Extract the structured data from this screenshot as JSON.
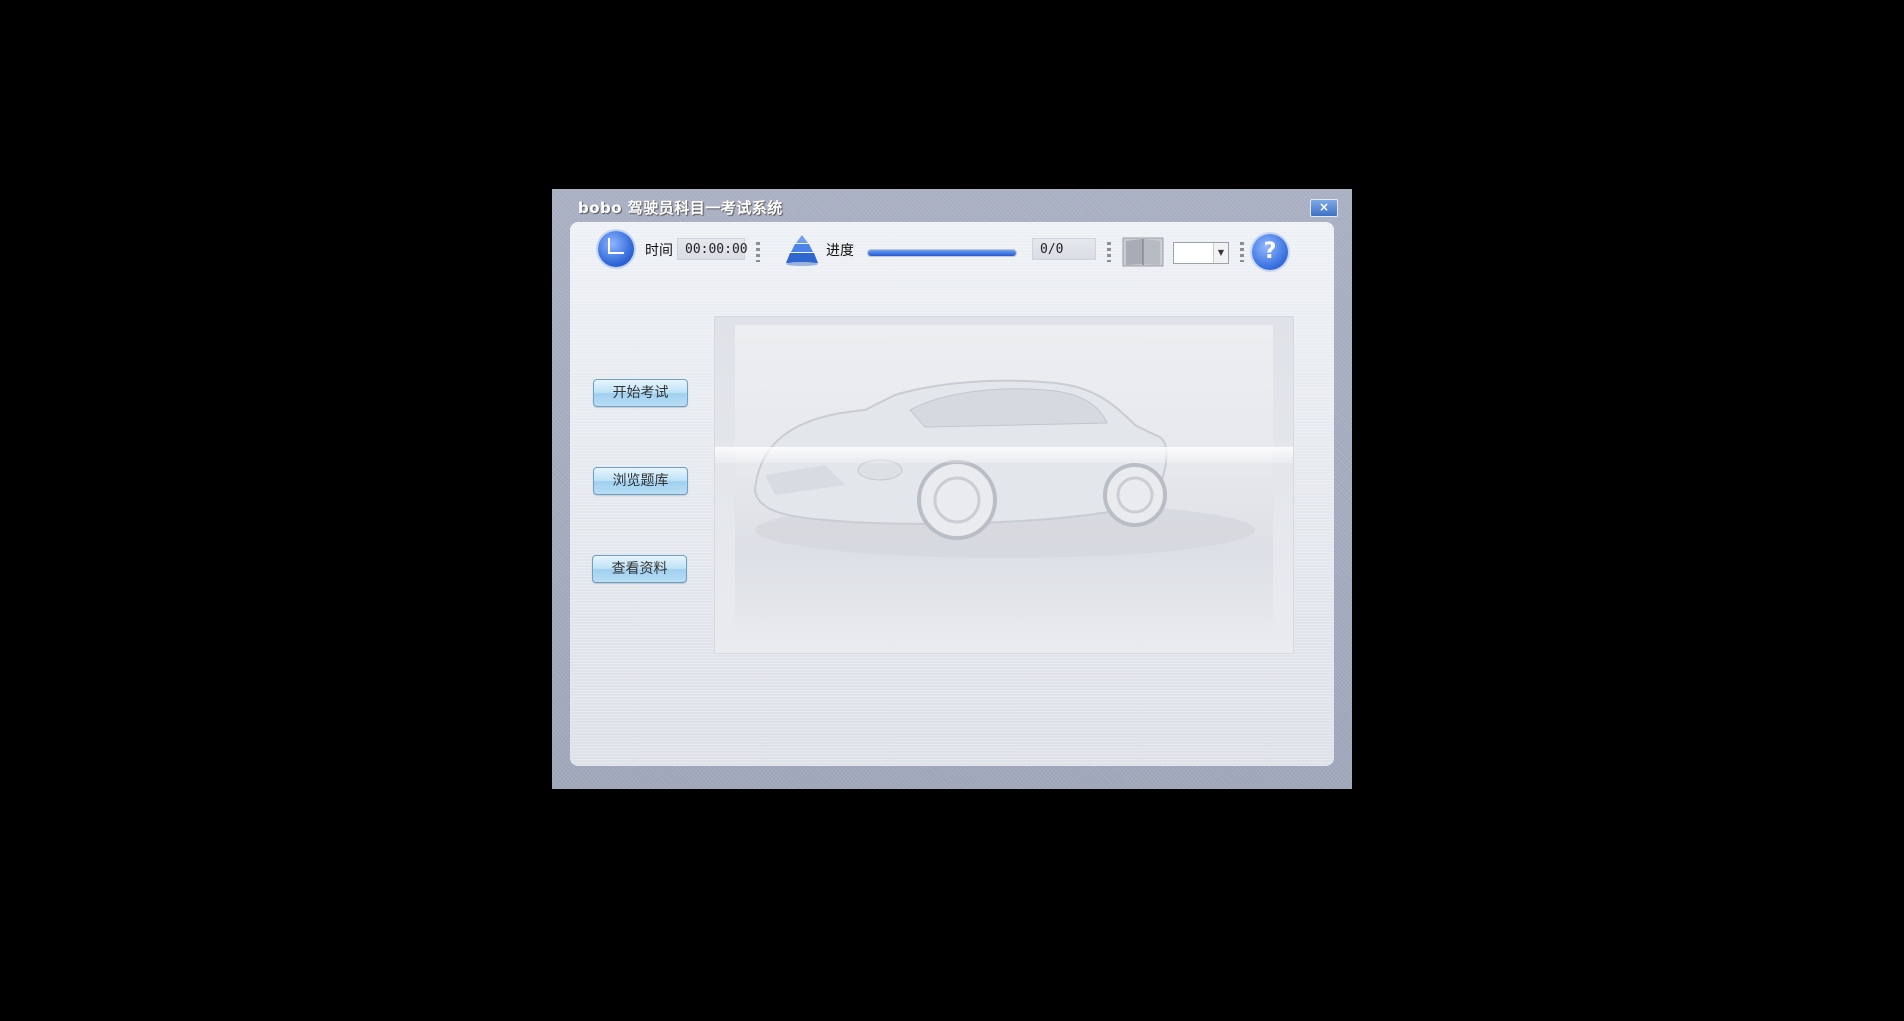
{
  "window": {
    "title": "bobo 驾驶员科目一考试系统",
    "close_label": "×"
  },
  "toolbar": {
    "time_label": "时间",
    "time_value": "00:00:00",
    "progress_label": "进度",
    "progress_fraction": 1.0,
    "count_value": "0/0",
    "select_value": "",
    "help_label": "?"
  },
  "sidebar": {
    "buttons": [
      {
        "label": "开始考试"
      },
      {
        "label": "浏览题库"
      },
      {
        "label": "查看资料"
      }
    ]
  },
  "colors": {
    "accent": "#2f67d8",
    "progress": "#2359d1",
    "button_face": "#bfe2f7"
  },
  "icons": [
    "clock-icon",
    "pyramid-icon",
    "book-icon",
    "help-icon",
    "close-icon"
  ]
}
